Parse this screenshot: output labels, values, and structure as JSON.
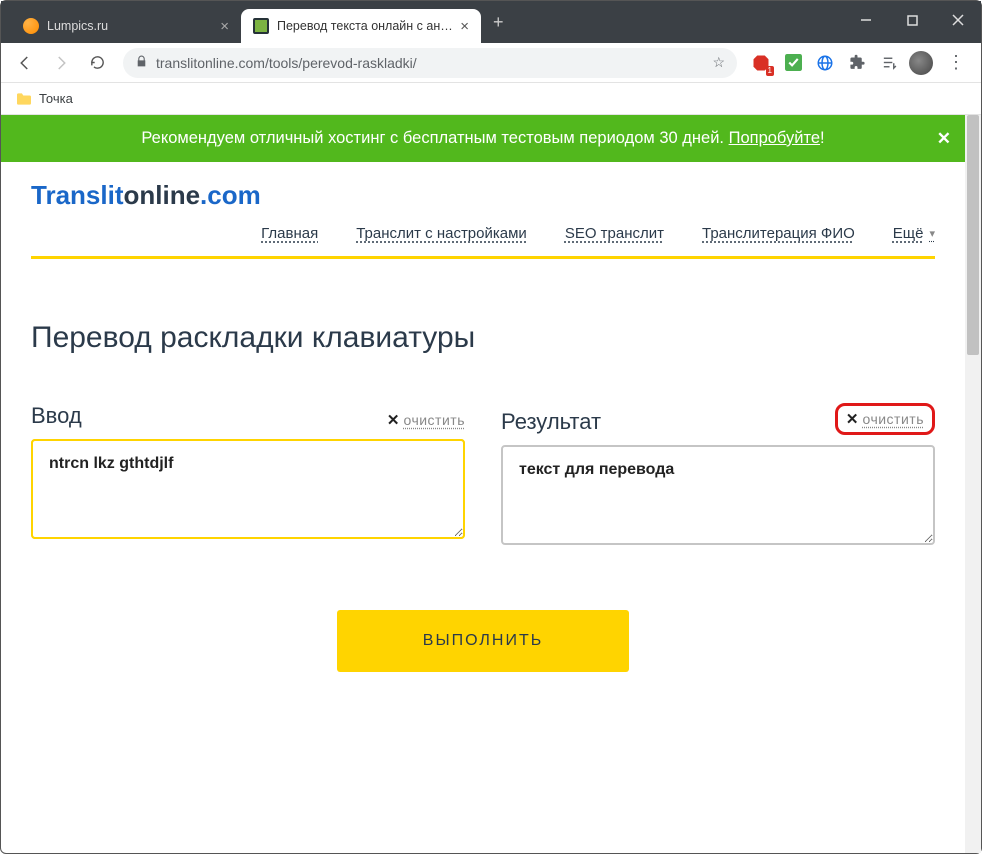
{
  "browser": {
    "tabs": [
      {
        "title": "Lumpics.ru"
      },
      {
        "title": "Перевод текста онлайн с англи"
      }
    ],
    "url": "translitonline.com/tools/perevod-raskladki/",
    "ext_badge": "1",
    "bookmark": "Точка"
  },
  "banner": {
    "text_a": "Рекомендуем отличный хостинг с бесплатным тестовым периодом 30 дней. ",
    "link": "Попробуйте",
    "text_b": "!"
  },
  "logo": {
    "p1": "Translit",
    "p2": "online",
    "p3": ".com"
  },
  "nav": {
    "items": [
      "Главная",
      "Транслит с настройками",
      "SEO транслит",
      "Транслитерация ФИО"
    ],
    "more": "Ещё"
  },
  "page": {
    "title": "Перевод раскладки клавиатуры",
    "input_label": "Ввод",
    "output_label": "Результат",
    "clear": "очистить",
    "input_value": "ntrcn lkz gthtdjlf",
    "output_value": "текст для перевода",
    "action": "ВЫПОЛНИТЬ"
  }
}
